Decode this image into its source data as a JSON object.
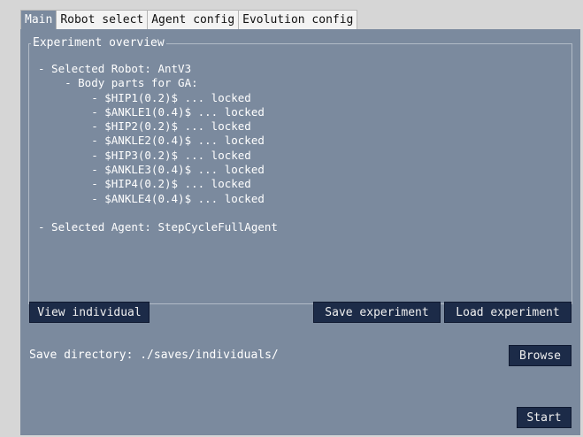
{
  "tabs": [
    {
      "label": "Main"
    },
    {
      "label": "Robot select"
    },
    {
      "label": "Agent config"
    },
    {
      "label": "Evolution config"
    }
  ],
  "overview": {
    "title": "Experiment overview",
    "text": "- Selected Robot: AntV3\n    - Body parts for GA:\n        - $HIP1(0.2)$ ... locked\n        - $ANKLE1(0.4)$ ... locked\n        - $HIP2(0.2)$ ... locked\n        - $ANKLE2(0.4)$ ... locked\n        - $HIP3(0.2)$ ... locked\n        - $ANKLE3(0.4)$ ... locked\n        - $HIP4(0.2)$ ... locked\n        - $ANKLE4(0.4)$ ... locked\n\n- Selected Agent: StepCycleFullAgent"
  },
  "buttons": {
    "view_individual": "View individual",
    "save_experiment": "Save experiment",
    "load_experiment": "Load experiment",
    "browse": "Browse",
    "start": "Start"
  },
  "save_directory": {
    "label": "Save directory: ./saves/individuals/"
  },
  "colors": {
    "panel": "#7b8a9e",
    "button": "#1c2b48",
    "active_tab": "#7b8a9e"
  }
}
